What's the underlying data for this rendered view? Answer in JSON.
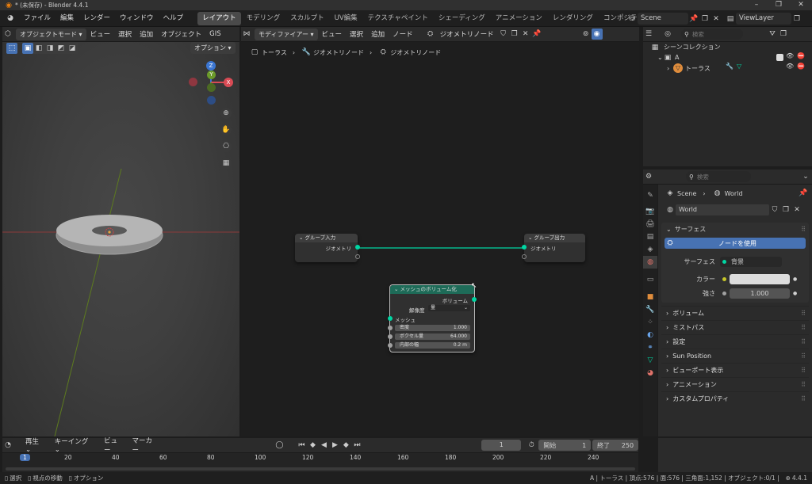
{
  "titlebar": {
    "title": "* (未保存) - Blender 4.4.1",
    "minimize": "–",
    "restore": "❐",
    "close": "✕"
  },
  "menu": [
    "ファイル",
    "編集",
    "レンダー",
    "ウィンドウ",
    "ヘルプ"
  ],
  "workspaces": [
    "レイアウト",
    "モデリング",
    "スカルプト",
    "UV編集",
    "テクスチャペイント",
    "シェーディング",
    "アニメーション",
    "レンダリング",
    "コンポジティング"
  ],
  "scene": "Scene",
  "viewlayer": "ViewLayer",
  "viewport": {
    "mode": "オブジェクトモード",
    "menus": [
      "ビュー",
      "選択",
      "追加",
      "オブジェクト",
      "GIS"
    ],
    "options": "オプション",
    "gizmo": {
      "z": "Z",
      "y": "Y",
      "x": "X"
    }
  },
  "node_editor": {
    "type": "モディファイアー",
    "menus": [
      "ビュー",
      "選択",
      "追加",
      "ノード"
    ],
    "tree": "ジオメトリノード",
    "breadcrumb": [
      "トーラス",
      "ジオメトリノード",
      "ジオメトリノード"
    ],
    "group_input": {
      "title": "グループ入力",
      "socket": "ジオメトリ"
    },
    "group_output": {
      "title": "グループ出力",
      "socket": "ジオメトリ"
    },
    "mesh_volume": {
      "title": "メッシュのボリューム化",
      "output": "ボリューム",
      "resolution_label": "解像度",
      "resolution": "量",
      "mesh": "メッシュ",
      "fields": [
        {
          "label": "密度",
          "value": "1.000"
        },
        {
          "label": "ボクセル量",
          "value": "64.000"
        },
        {
          "label": "内部の幅",
          "value": "0.2 m"
        }
      ]
    }
  },
  "outliner": {
    "search": "検索",
    "collection": "シーンコレクション",
    "items": [
      {
        "name": "A"
      },
      {
        "name": "トーラス"
      }
    ]
  },
  "properties": {
    "search": "検索",
    "breadcrumb": [
      "Scene",
      "World"
    ],
    "world": "World",
    "surface": {
      "title": "サーフェス",
      "use_nodes": "ノードを使用",
      "surface_label": "サーフェス",
      "surface_value": "背景",
      "color_label": "カラー",
      "strength_label": "強さ",
      "strength": "1.000",
      "color": "#dddddd"
    },
    "panels": [
      "ボリューム",
      "ミストパス",
      "設定",
      "Sun Position",
      "ビューポート表示",
      "アニメーション",
      "カスタムプロパティ"
    ]
  },
  "timeline": {
    "play": "再生",
    "keying": "キーイング",
    "menus": [
      "ビュー",
      "マーカー"
    ],
    "current": "1",
    "start_label": "開始",
    "start": "1",
    "end_label": "終了",
    "end": "250",
    "ticks": [
      "1",
      "20",
      "40",
      "60",
      "80",
      "100",
      "120",
      "140",
      "160",
      "180",
      "200",
      "220",
      "240"
    ]
  },
  "status": {
    "left": [
      {
        "icon": "mouse-left",
        "label": "選択"
      },
      {
        "icon": "mouse-mid",
        "label": "視点の移動"
      },
      {
        "icon": "mouse-right",
        "label": "オプション"
      }
    ],
    "right": "A | トーラス | 頂点:576 | 面:576 | 三角面:1,152 | オブジェクト:0/1 |",
    "version": "4.4.1"
  },
  "colors": {
    "accent": "#4772b3",
    "geometry": "#00d6a3",
    "active_tab": "#4a4a4a",
    "node_header": "#1e6b58"
  }
}
